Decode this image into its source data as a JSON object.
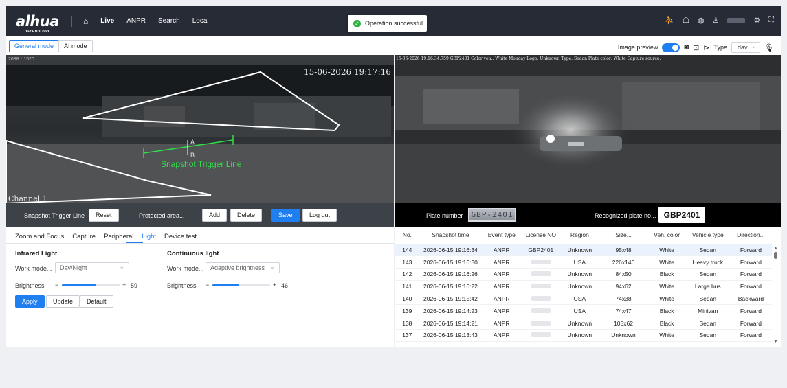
{
  "brand": {
    "logo": "alhua",
    "sub": "TECHNOLOGY"
  },
  "nav": {
    "home_icon": "home-icon",
    "items": [
      "Live",
      "ANPR",
      "Search",
      "Local"
    ],
    "active": "Live"
  },
  "toast": {
    "text": "Operation successful.",
    "icon": "check-circle-icon"
  },
  "header_icons": [
    "person-walk-icon",
    "notification-icon",
    "globe-icon",
    "user-icon",
    "settings-icon",
    "fullscreen-icon"
  ],
  "modes": {
    "general": "General mode",
    "ai": "AI mode"
  },
  "preview": {
    "label": "Image preview",
    "type_label": "Type",
    "type_value": "dav"
  },
  "left_video": {
    "resolution": "2688 * 1520",
    "timestamp": "15-06-2026 19:17:16",
    "channel": "Channel 1",
    "line_a": "A",
    "line_b": "B",
    "line_label": "Snapshot Trigger Line"
  },
  "right_video": {
    "caption": "15-06-2026 19:16:34.759 GBP2401 Color veh.: White Monday Logo: Unknown Type: Sedan Plate color: White Capture source:"
  },
  "controls": {
    "trigger_label": "Snapshot Trigger Line",
    "reset": "Reset",
    "protected": "Protected area...",
    "add": "Add",
    "delete": "Delete",
    "save": "Save",
    "logout": "Log out"
  },
  "plate": {
    "label": "Plate number",
    "image_text": "GBP-2401",
    "recognized_label": "Recognized plate no...",
    "recognized_value": "GBP2401"
  },
  "settings": {
    "tabs": [
      "Zoom and Focus",
      "Capture",
      "Peripheral",
      "Light",
      "Device test"
    ],
    "active_tab": "Light",
    "infrared": {
      "title": "Infrared Light",
      "mode_label": "Work mode...",
      "mode_value": "Day/Night",
      "brightness_label": "Brightness",
      "minus": "−",
      "plus": "+",
      "value": "59",
      "level": 59
    },
    "continuous": {
      "title": "Continuous light",
      "mode_label": "Work mode...",
      "mode_value": "Adaptive brightness",
      "brightness_label": "Brightness",
      "minus": "−",
      "plus": "+",
      "value": "46",
      "level": 46
    },
    "apply": "Apply",
    "update": "Update",
    "default": "Default"
  },
  "table": {
    "headers": [
      "No.",
      "Snapshot time",
      "Event type",
      "License NO",
      "Region",
      "Size...",
      "Veh. color",
      "Vehicle type",
      "Direction..."
    ],
    "rows": [
      [
        "144",
        "2026-06-15 19:16:34",
        "ANPR",
        "GBP2401",
        "Unknown",
        "95x48",
        "White",
        "Sedan",
        "Forward"
      ],
      [
        "143",
        "2026-06-15 19:16:30",
        "ANPR",
        "",
        "USA",
        "226x146",
        "White",
        "Heavy truck",
        "Forward"
      ],
      [
        "142",
        "2026-06-15 19:16:26",
        "ANPR",
        "",
        "Unknown",
        "84x50",
        "Black",
        "Sedan",
        "Forward"
      ],
      [
        "141",
        "2026-06-15 19:16:22",
        "ANPR",
        "",
        "Unknown",
        "94x62",
        "White",
        "Large bus",
        "Forward"
      ],
      [
        "140",
        "2026-06-15 19:15:42",
        "ANPR",
        "",
        "USA",
        "74x38",
        "White",
        "Sedan",
        "Backward"
      ],
      [
        "139",
        "2026-06-15 19:14:23",
        "ANPR",
        "",
        "USA",
        "74x47",
        "Black",
        "Minivan",
        "Forward"
      ],
      [
        "138",
        "2026-06-15 19:14:21",
        "ANPR",
        "",
        "Unknown",
        "105x62",
        "Black",
        "Sedan",
        "Forward"
      ],
      [
        "137",
        "2026-06-15 19:13:43",
        "ANPR",
        "",
        "Unknown",
        "Unknown",
        "White",
        "Sedan",
        "Forward"
      ]
    ]
  }
}
